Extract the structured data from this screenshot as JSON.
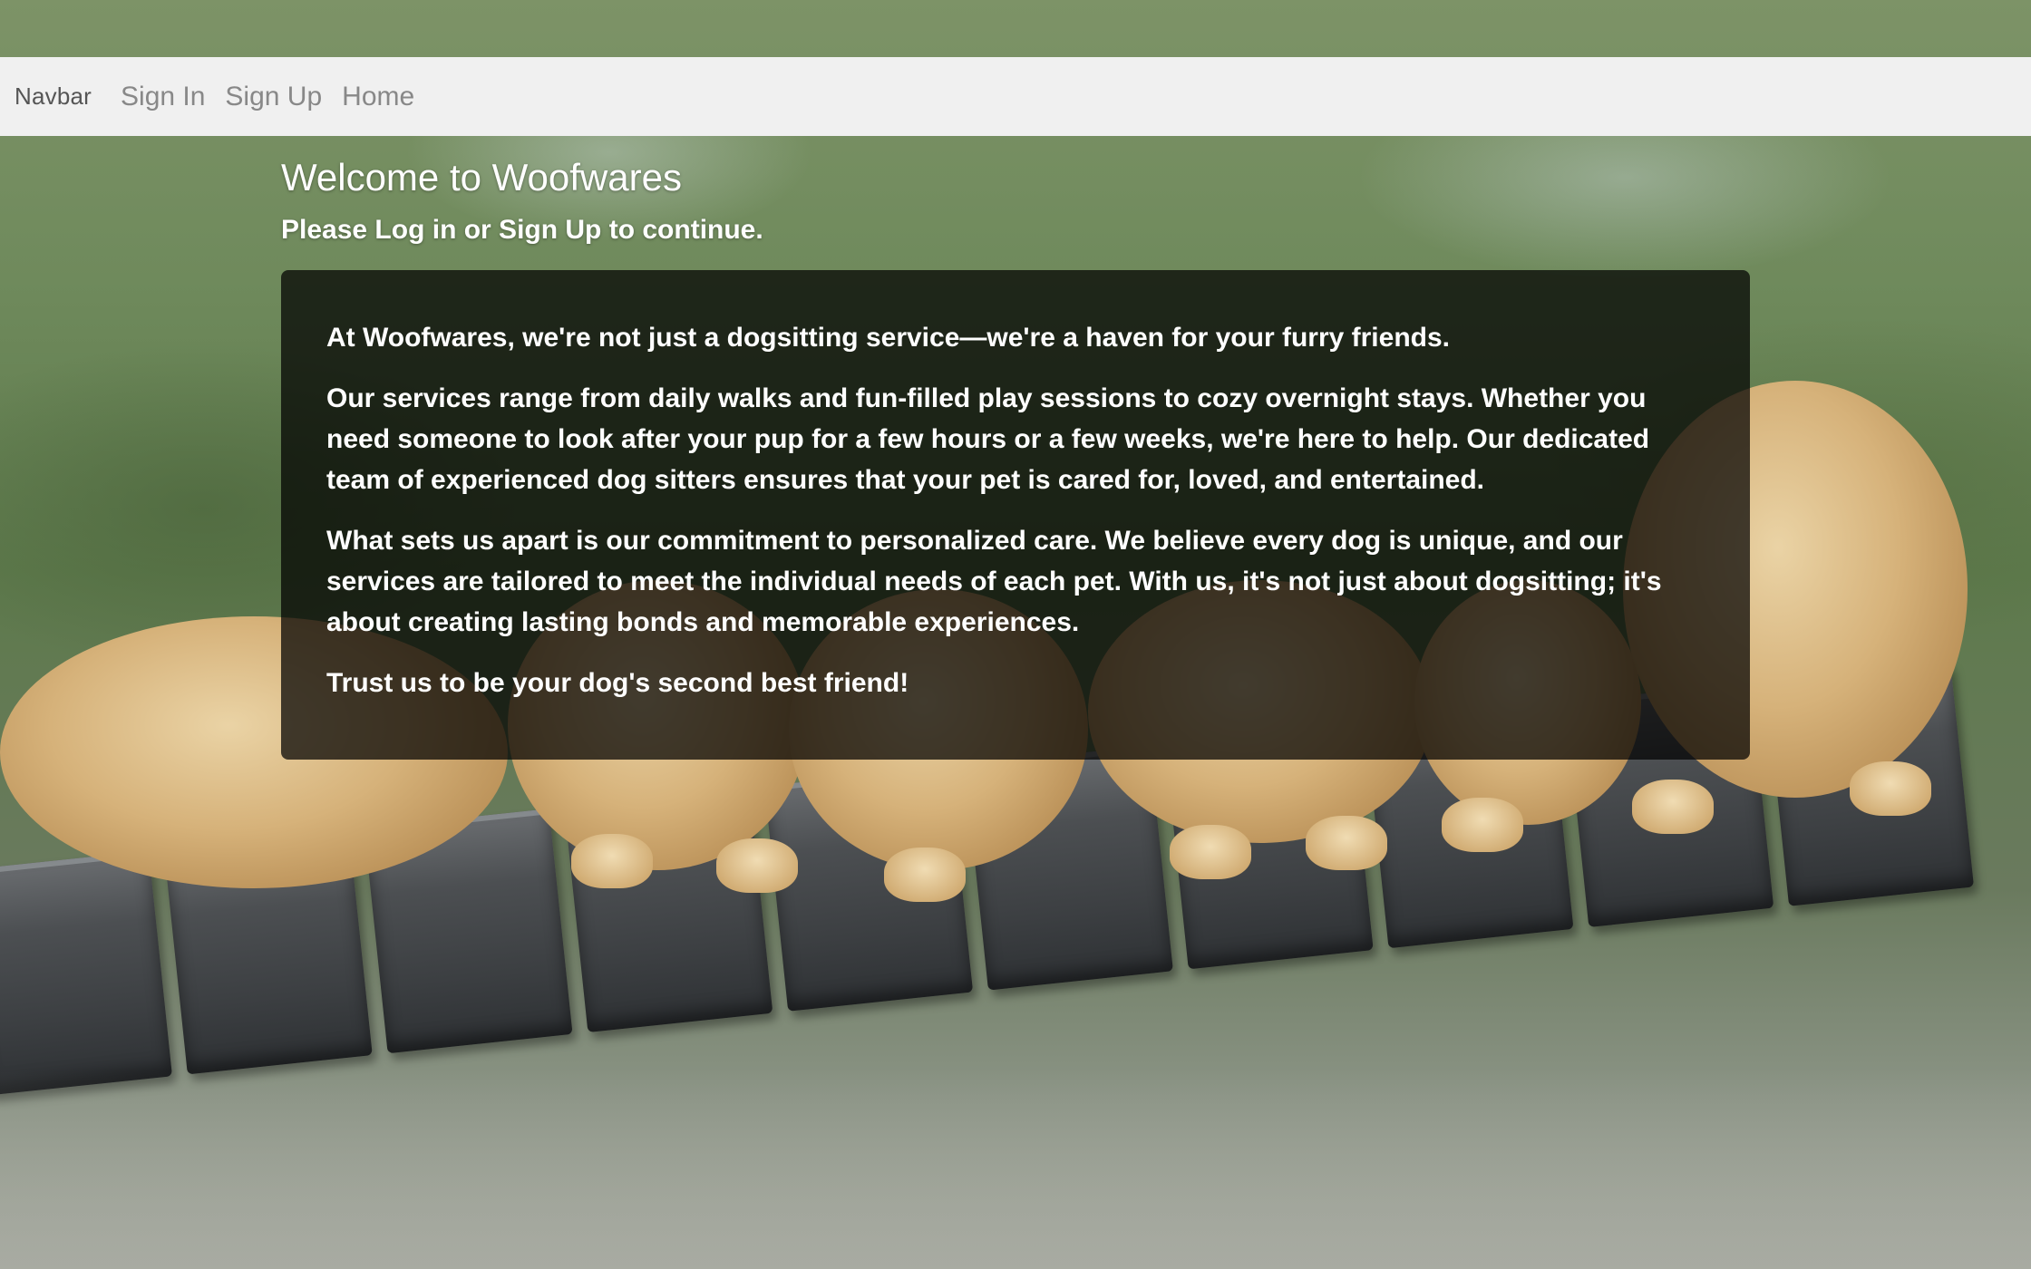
{
  "navbar": {
    "brand": "Navbar",
    "links": [
      "Sign In",
      "Sign Up",
      "Home"
    ]
  },
  "main": {
    "title": "Welcome to Woofwares",
    "subtitle": "Please Log in or Sign Up to continue.",
    "paragraphs": [
      "At Woofwares, we're not just a dogsitting service—we're a haven for your furry friends.",
      "Our services range from daily walks and fun-filled play sessions to cozy overnight stays. Whether you need someone to look after your pup for a few hours or a few weeks, we're here to help. Our dedicated team of experienced dog sitters ensures that your pet is cared for, loved, and entertained.",
      "What sets us apart is our commitment to personalized care. We believe every dog is unique, and our services are tailored to meet the individual needs of each pet. With us, it's not just about dogsitting; it's about creating lasting bonds and memorable experiences.",
      "Trust us to be your dog's second best friend!"
    ]
  },
  "background": {
    "image": "puppies-on-wooden-bridge-photo"
  },
  "colors": {
    "navbar_bg": "#f0f0f0",
    "nav_link": "#888888",
    "brand": "#555555",
    "card_bg": "rgba(0,0,0,0.72)",
    "text_light": "#ffffff"
  }
}
